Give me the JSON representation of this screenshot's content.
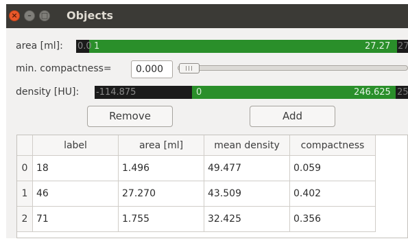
{
  "window": {
    "title": "Objects"
  },
  "filters": {
    "area": {
      "label": "area [ml]:",
      "min_text": "0.0",
      "low_value": "1",
      "high_value": "27.27",
      "max_text": "27"
    },
    "compactness": {
      "label": "min. compactness=",
      "value": "0.000"
    },
    "density": {
      "label": "density [HU]:",
      "min_text": "-114.875",
      "low_value": "0",
      "high_value": "246.625",
      "max_text": "25"
    }
  },
  "buttons": {
    "remove": "Remove",
    "add": "Add"
  },
  "table": {
    "columns": [
      "label",
      "area [ml]",
      "mean density",
      "compactness"
    ],
    "row_indices": [
      "0",
      "1",
      "2"
    ],
    "rows": [
      [
        "18",
        "1.496",
        "49.477",
        "0.059"
      ],
      [
        "46",
        "27.270",
        "43.509",
        "0.402"
      ],
      [
        "71",
        "1.755",
        "32.425",
        "0.356"
      ]
    ]
  },
  "colors": {
    "titlebar": "#3b3a36",
    "range_fill": "#2a8f2a",
    "range_bg": "#1b1b1b",
    "close_button": "#e8582a"
  }
}
